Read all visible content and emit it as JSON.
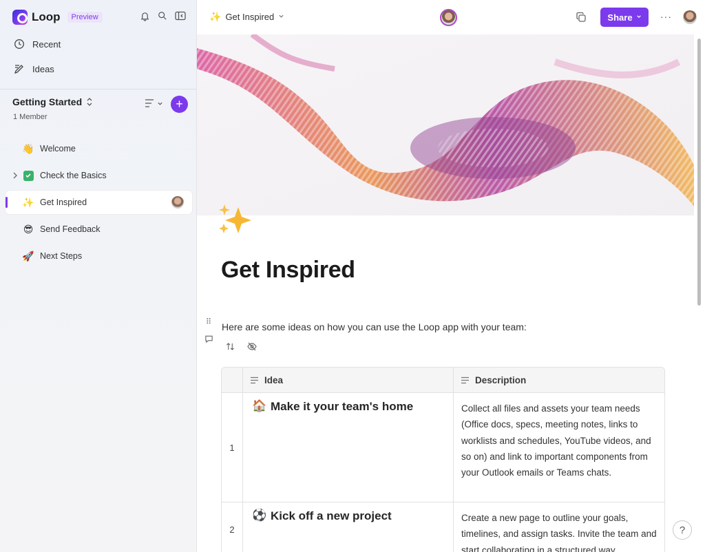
{
  "app": {
    "name": "Loop",
    "badge": "Preview"
  },
  "sidebar": {
    "nav": [
      {
        "label": "Recent",
        "icon": "clock-icon"
      },
      {
        "label": "Ideas",
        "icon": "ideas-icon"
      }
    ],
    "workspace": {
      "title": "Getting Started",
      "members": "1 Member"
    },
    "pages": [
      {
        "label": "Welcome",
        "icon": "waving-hand-icon",
        "emoji": "👋"
      },
      {
        "label": "Check the Basics",
        "icon": "checkbox-icon",
        "has_children": true
      },
      {
        "label": "Get Inspired",
        "icon": "sparkles-icon",
        "emoji": "✨",
        "active": true
      },
      {
        "label": "Send Feedback",
        "icon": "smiley-sunglasses-icon",
        "emoji": "😎"
      },
      {
        "label": "Next Steps",
        "icon": "rocket-icon",
        "emoji": "🚀"
      }
    ]
  },
  "topbar": {
    "breadcrumb": "Get Inspired",
    "share_label": "Share"
  },
  "page": {
    "title": "Get Inspired",
    "intro": "Here are some ideas on how you can use the Loop app with your team:",
    "table": {
      "columns": [
        "Idea",
        "Description"
      ],
      "rows": [
        {
          "num": "1",
          "emoji": "🏠",
          "idea": "Make it your team's home",
          "description": "Collect all files and assets your team needs (Office docs, specs, meeting notes, links to worklists and schedules, YouTube videos, and so on) and link to important components from your Outlook emails or Teams chats."
        },
        {
          "num": "2",
          "emoji": "⚽",
          "idea": "Kick off a new project",
          "description": "Create a new page to outline your goals, timelines, and assign tasks. Invite the team and start collaborating in a structured way."
        }
      ]
    }
  },
  "help": {
    "label": "?"
  },
  "colors": {
    "accent": "#7c3aed",
    "check_green": "#3ab26b"
  }
}
